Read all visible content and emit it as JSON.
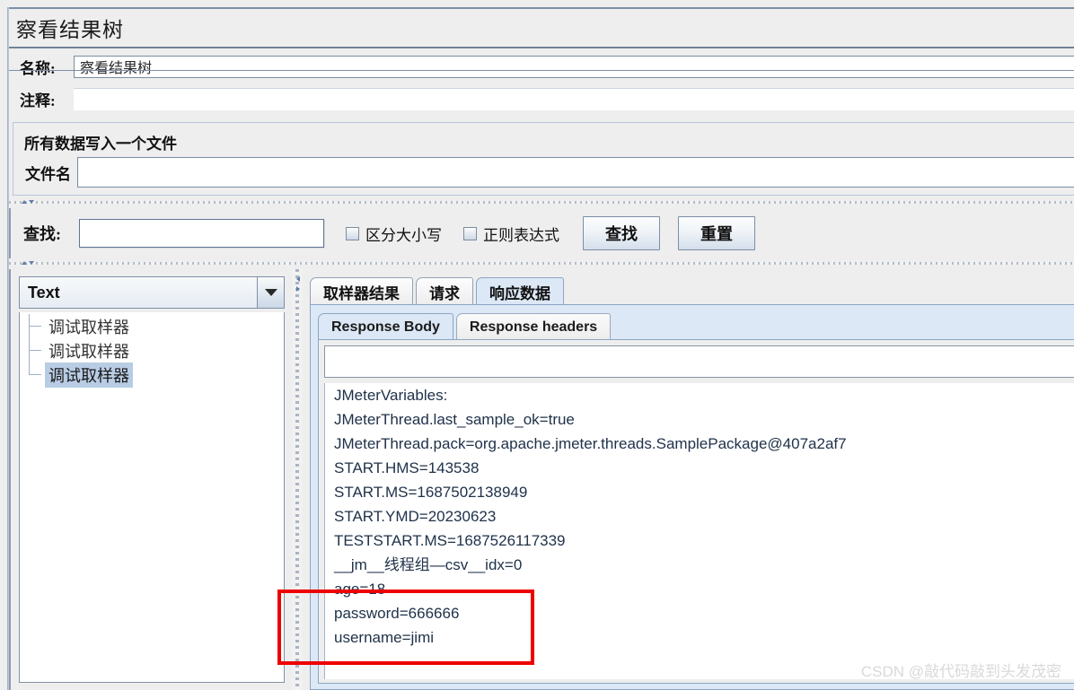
{
  "window": {
    "title": "察看结果树"
  },
  "form": {
    "name_label": "名称:",
    "name_value": "察看结果树",
    "comment_label": "注释:",
    "comment_value": ""
  },
  "file_group": {
    "title": "所有数据写入一个文件",
    "filename_label": "文件名",
    "filename_value": ""
  },
  "search": {
    "label": "查找:",
    "value": "",
    "case_sensitive_label": "区分大小写",
    "case_sensitive_checked": false,
    "regex_label": "正则表达式",
    "regex_checked": false,
    "find_button": "查找",
    "reset_button": "重置"
  },
  "left_panel": {
    "render_combo_value": "Text",
    "combo_arrow_icon": "chevron-down-icon",
    "tree_items": [
      {
        "label": "调试取样器",
        "selected": false
      },
      {
        "label": "调试取样器",
        "selected": false
      },
      {
        "label": "调试取样器",
        "selected": true
      }
    ]
  },
  "result_tabs": [
    {
      "label": "取样器结果",
      "active": false
    },
    {
      "label": "请求",
      "active": false
    },
    {
      "label": "响应数据",
      "active": true
    }
  ],
  "response_subtabs": [
    {
      "label": "Response Body",
      "active": true
    },
    {
      "label": "Response headers",
      "active": false
    }
  ],
  "response": {
    "search_field_value": "",
    "body_lines": [
      "JMeterVariables:",
      "JMeterThread.last_sample_ok=true",
      "JMeterThread.pack=org.apache.jmeter.threads.SamplePackage@407a2af7",
      "START.HMS=143538",
      "START.MS=1687502138949",
      "START.YMD=20230623",
      "TESTSTART.MS=1687526117339",
      "__jm__线程组—csv__idx=0",
      "age=18",
      "password=666666",
      "username=jimi"
    ]
  },
  "annotation": {
    "type": "red-rectangle",
    "color": "#ee0000",
    "highlighted_lines": [
      "age=18",
      "password=666666",
      "username=jimi"
    ]
  },
  "watermark": {
    "text": "CSDN @敲代码敲到头发茂密"
  },
  "colors": {
    "panel_background": "#eeeeee",
    "selected_tab": "#dce8f6",
    "tree_selection": "#b8cce4",
    "border": "#8ba5c4",
    "annotation": "#ee0000"
  }
}
